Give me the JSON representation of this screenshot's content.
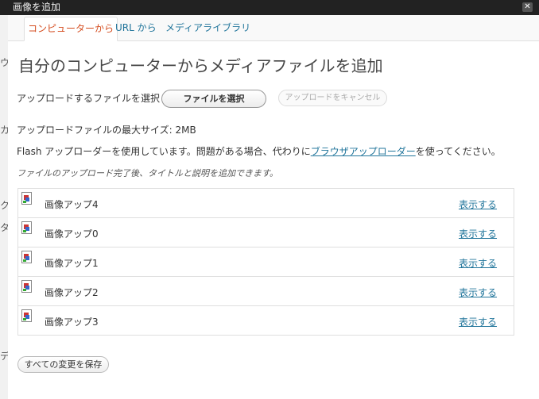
{
  "window": {
    "title": "画像を追加",
    "close_glyph": "✕"
  },
  "tabs": [
    {
      "label": "コンピューターから",
      "active": true
    },
    {
      "label": "URL から",
      "active": false
    },
    {
      "label": "メディアライブラリ",
      "active": false
    }
  ],
  "main": {
    "title": "自分のコンピューターからメディアファイルを追加",
    "select_label": "アップロードするファイルを選択",
    "select_button": "ファイルを選択",
    "cancel_button": "アップロードをキャンセル",
    "max_size": "アップロードファイルの最大サイズ: 2MB",
    "flash_text_before": "Flash アップローダーを使用しています。問題がある場合、代わりに",
    "flash_link": "ブラウザアップローダー",
    "flash_text_after": "を使ってください。",
    "hint": "ファイルのアップロード完了後、タイトルと説明を追加できます。"
  },
  "files": [
    {
      "name": "画像アップ4",
      "action": "表示する"
    },
    {
      "name": "画像アップ0",
      "action": "表示する"
    },
    {
      "name": "画像アップ1",
      "action": "表示する"
    },
    {
      "name": "画像アップ2",
      "action": "表示する"
    },
    {
      "name": "画像アップ3",
      "action": "表示する"
    }
  ],
  "footer": {
    "save_all": "すべての変更を保存"
  },
  "background": {
    "chars": [
      "ウ",
      "カ",
      "ク",
      "タ",
      "デ"
    ]
  },
  "colors": {
    "link": "#21759b",
    "active_tab": "#d54e21",
    "border": "#dfdfdf"
  }
}
